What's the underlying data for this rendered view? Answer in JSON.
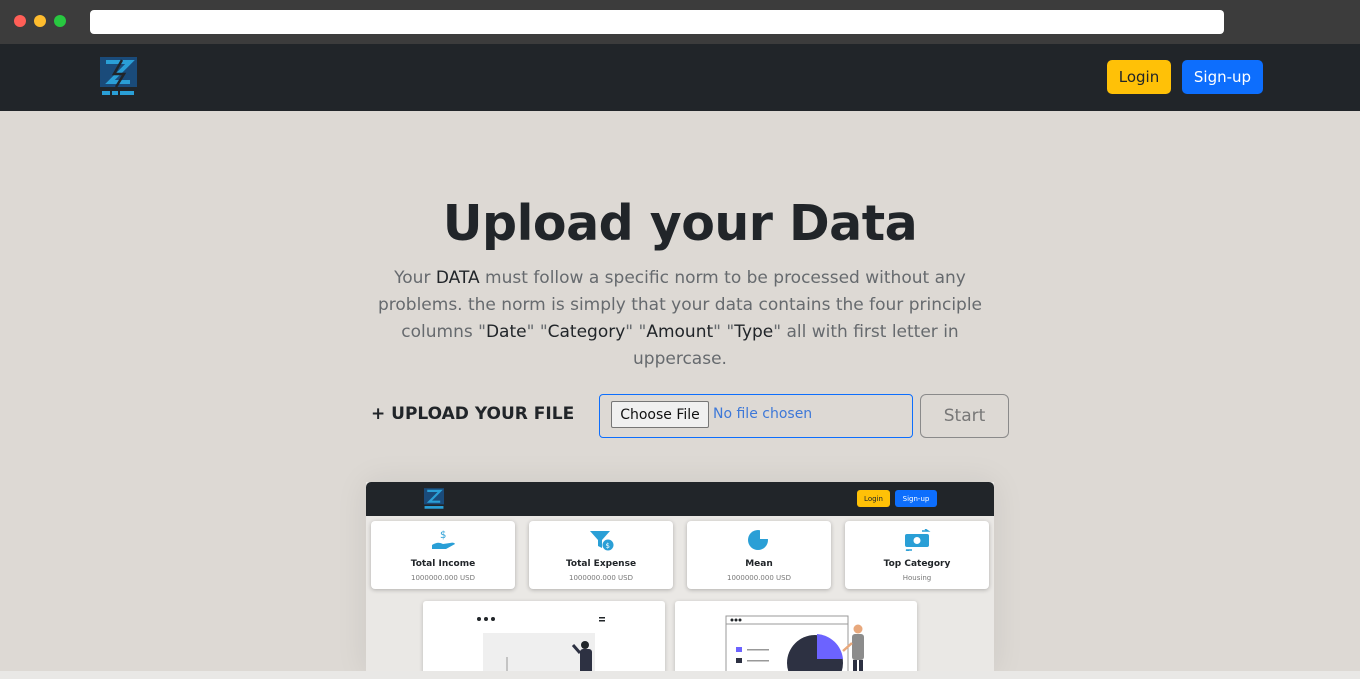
{
  "navbar": {
    "login_label": "Login",
    "signup_label": "Sign-up"
  },
  "hero": {
    "title": "Upload your Data",
    "desc_1": "Your ",
    "desc_data": "DATA",
    "desc_2": " must follow a specific norm to be processed without any problems. the norm is simply that your data contains the four principle columns \"",
    "desc_date": "Date",
    "desc_3": "\" \"",
    "desc_category": "Category",
    "desc_4": "\" \"",
    "desc_amount": "Amount",
    "desc_5": "\" \"",
    "desc_type": "Type",
    "desc_6": "\" all with first letter in uppercase."
  },
  "upload": {
    "label": "+ UPLOAD YOUR FILE",
    "choose_label": "Choose File",
    "no_file_text": "No file chosen",
    "start_label": "Start"
  },
  "preview": {
    "login_label": "Login",
    "signup_label": "Sign-up",
    "cards": [
      {
        "title": "Total Income",
        "value": "1000000.000 USD",
        "icon": "hand-dollar-icon"
      },
      {
        "title": "Total Expense",
        "value": "1000000.000 USD",
        "icon": "funnel-dollar-icon"
      },
      {
        "title": "Mean",
        "value": "1000000.000 USD",
        "icon": "pie-chart-icon"
      },
      {
        "title": "Top Category",
        "value": "Housing",
        "icon": "money-exchange-icon"
      }
    ]
  },
  "colors": {
    "navbar_bg": "#212529",
    "login_bg": "#ffc107",
    "signup_bg": "#0d6efd",
    "page_bg": "#ddd9d4",
    "accent_teal": "#2a9fd6",
    "accent_purple": "#6c63ff"
  }
}
